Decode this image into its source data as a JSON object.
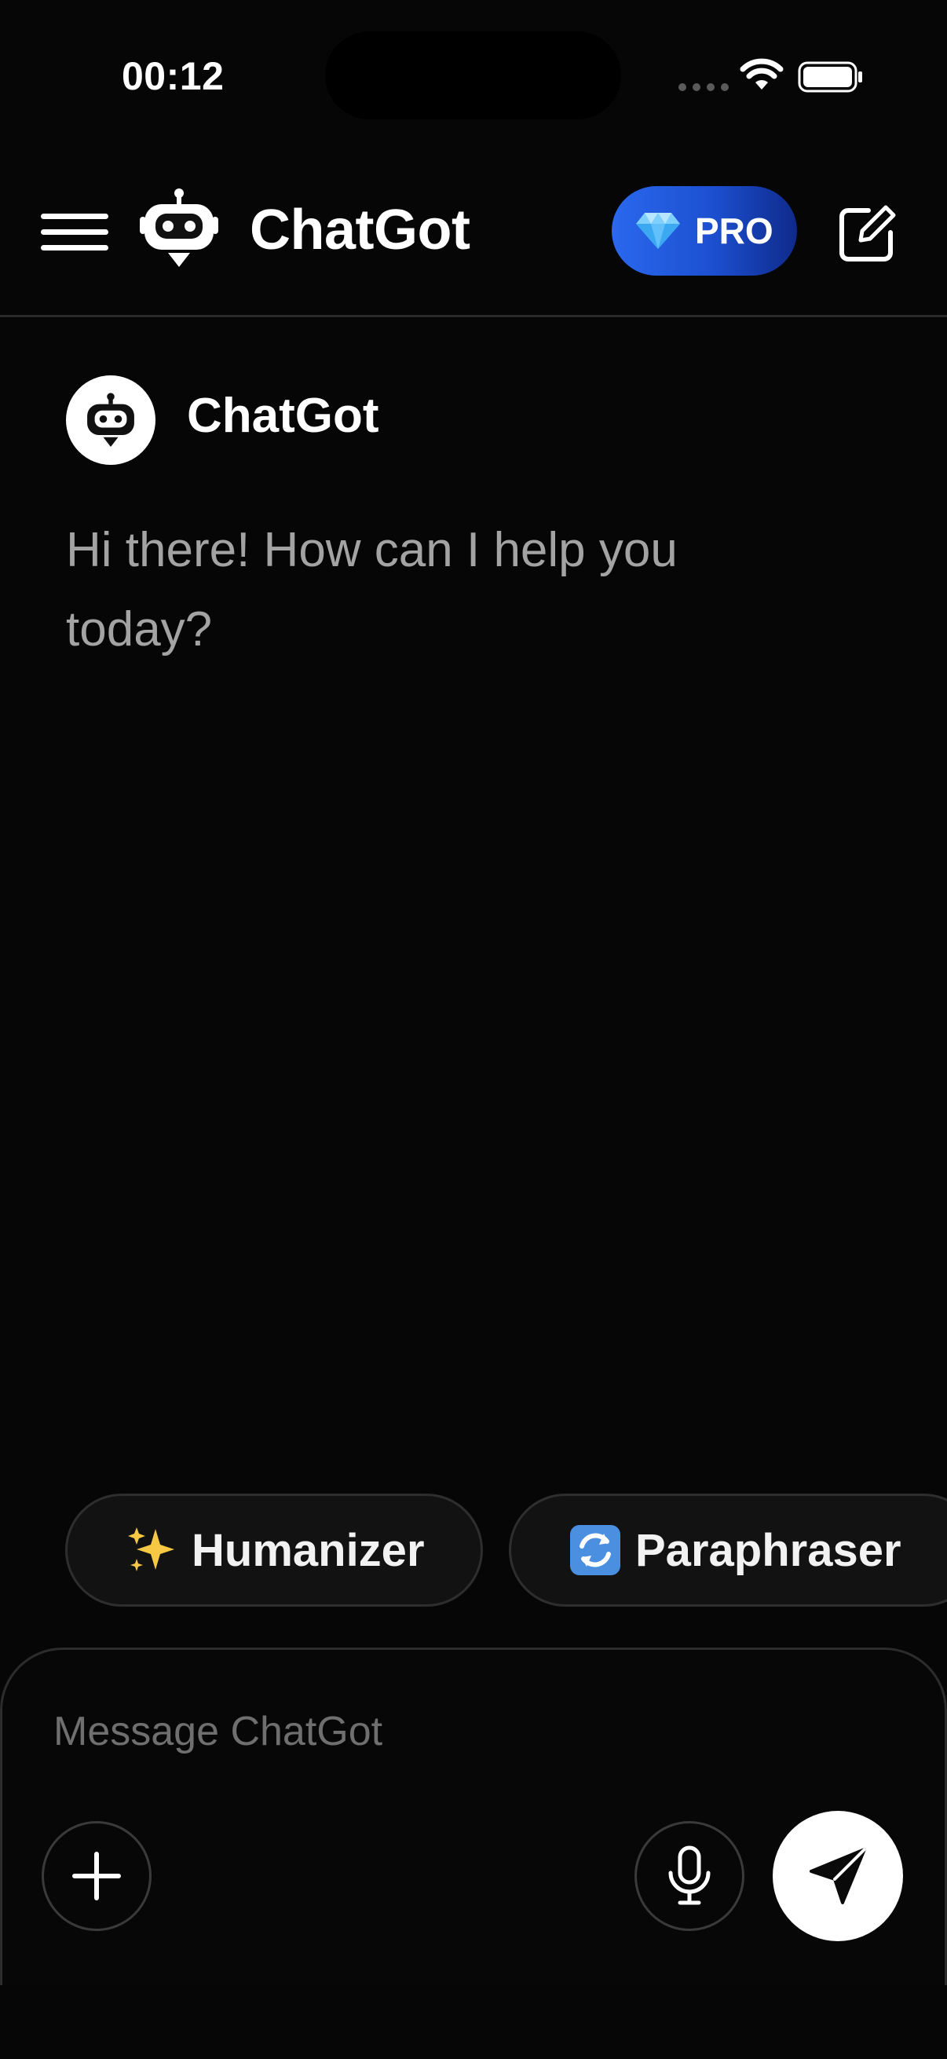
{
  "status_bar": {
    "time": "00:12"
  },
  "header": {
    "title": "ChatGot",
    "pro_label": "PRO",
    "icons": {
      "menu": "hamburger-menu-icon",
      "logo": "robot-icon",
      "pro": "diamond-icon",
      "new_chat": "compose-icon"
    },
    "accent_color": "#1f55d8"
  },
  "conversation": {
    "bot_name": "ChatGot",
    "messages": [
      {
        "sender": "bot",
        "text": "Hi there! How can I help you today?"
      }
    ]
  },
  "suggestions": [
    {
      "icon": "sparkles-icon",
      "label": "Humanizer"
    },
    {
      "icon": "refresh-icon",
      "label": "Paraphraser"
    }
  ],
  "composer": {
    "placeholder": "Message ChatGot",
    "value": "",
    "icons": {
      "attach": "plus-icon",
      "mic": "microphone-icon",
      "send": "send-icon"
    }
  }
}
